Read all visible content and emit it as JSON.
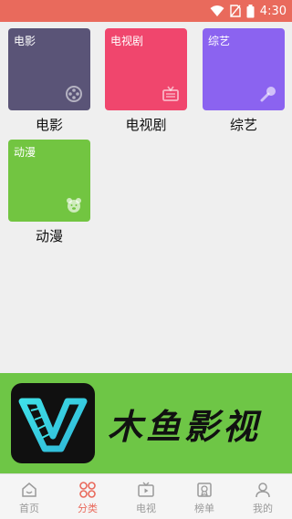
{
  "status_bar": {
    "time": "4:30",
    "color": "#e96a5c"
  },
  "categories": [
    {
      "label": "电影",
      "name": "电影",
      "color": "#5a5477",
      "icon": "film-reel-icon"
    },
    {
      "label": "电视剧",
      "name": "电视剧",
      "color": "#f0466d",
      "icon": "tv-icon"
    },
    {
      "label": "综艺",
      "name": "综艺",
      "color": "#8b63f0",
      "icon": "microphone-icon"
    },
    {
      "label": "动漫",
      "name": "动漫",
      "color": "#72c541",
      "icon": "bear-face-icon"
    }
  ],
  "banner": {
    "title": "木鱼影视",
    "bg": "#6ec646"
  },
  "bottom_nav": [
    {
      "label": "首页",
      "icon": "home-icon",
      "active": false
    },
    {
      "label": "分类",
      "icon": "category-icon",
      "active": true
    },
    {
      "label": "电视",
      "icon": "tv-icon",
      "active": false
    },
    {
      "label": "榜单",
      "icon": "ranking-icon",
      "active": false
    },
    {
      "label": "我的",
      "icon": "user-icon",
      "active": false
    }
  ]
}
